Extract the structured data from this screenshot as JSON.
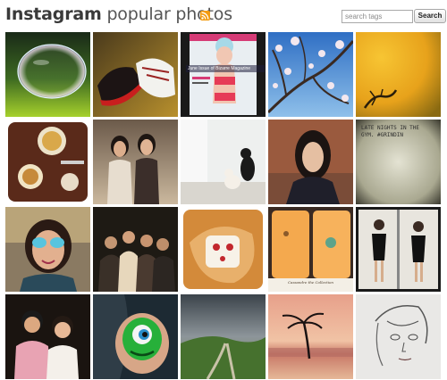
{
  "header": {
    "brand": "Instagram",
    "title_rest": " popular photos",
    "feed_icon": "rss-feed-icon"
  },
  "search": {
    "placeholder": "search tags",
    "value": "",
    "button_label": "Search"
  },
  "colors": {
    "title": "#3a3a3a",
    "rss": "#f39c12",
    "background": "#ffffff"
  },
  "photos": [
    {
      "subject": "soap bubble over green grass"
    },
    {
      "subject": "red-soled sneakers on wooden floor"
    },
    {
      "subject": "magazine cover",
      "caption": "June Issue of Bizarre Magazine"
    },
    {
      "subject": "cherry blossom branches against blue sky"
    },
    {
      "subject": "small lizard on yellow background"
    },
    {
      "subject": "desserts on a table"
    },
    {
      "subject": "two women posing"
    },
    {
      "subject": "cats in a white room"
    },
    {
      "subject": "woman with dark hair"
    },
    {
      "subject": "grungy text note",
      "caption": "LATE NIGHTS IN THE\nGYM. #GRINDIN"
    },
    {
      "subject": "woman wearing mirrored sunglasses"
    },
    {
      "subject": "group of friends at night"
    },
    {
      "subject": "hand holding a cute trinket"
    },
    {
      "subject": "phone cases on a wall",
      "caption": "Cassandre the Collection"
    },
    {
      "subject": "woman in a black dress mirrored"
    },
    {
      "subject": "two people smiling"
    },
    {
      "subject": "green monster tattoo on arm"
    },
    {
      "subject": "stormy sky over green hills"
    },
    {
      "subject": "palm tree at sunset beach"
    },
    {
      "subject": "pencil sketch of a girl"
    }
  ]
}
